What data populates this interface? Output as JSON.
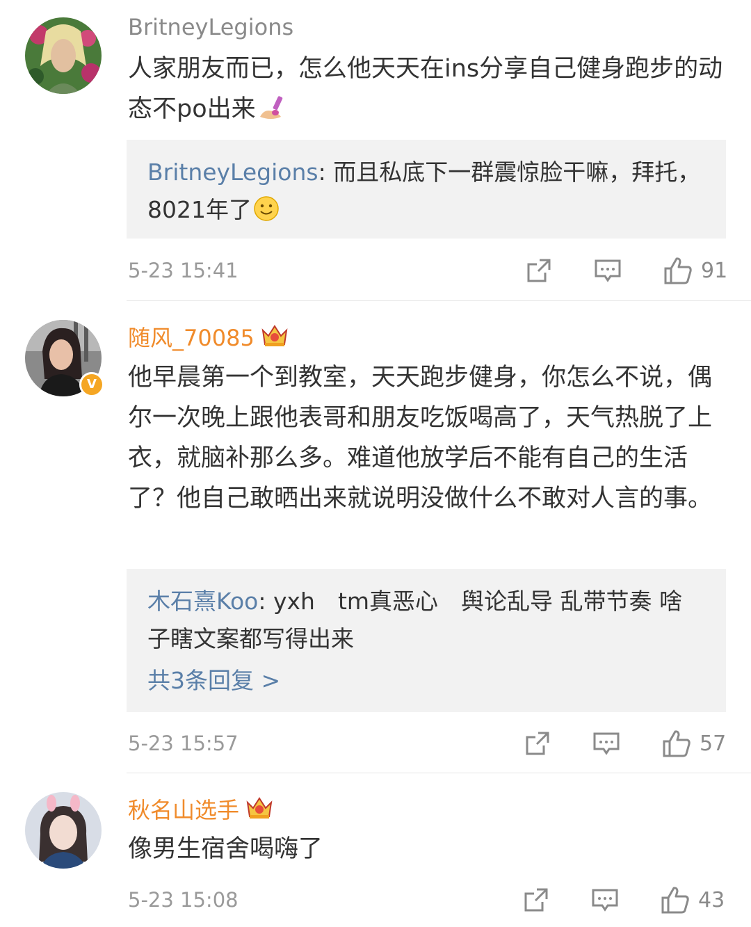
{
  "comments": [
    {
      "user": "BritneyLegions",
      "text": "人家朋友而已，怎么他天天在ins分享自己健身跑步的动态不po出来",
      "emoji": "nail-polish-emoji",
      "reply_user": "BritneyLegions",
      "reply_text": ": 而且私底下一群震惊脸干嘛，拜托，8021年了",
      "reply_emoji": "smile-emoji",
      "time": "5-23 15:41",
      "likes": "91"
    },
    {
      "user": "随风_70085",
      "badge": "crown-icon",
      "verified": "V",
      "text": "他早晨第一个到教室，天天跑步健身，你怎么不说，偶尔一次晚上跟他表哥和朋友吃饭喝高了，天气热脱了上衣，就脑补那么多。难道他放学后不能有自己的生活了？他自己敢晒出来就说明没做什么不敢对人言的事。",
      "reply_user": "木石熹Koo",
      "reply_text": ": yxh　tm真恶心　舆论乱导 乱带节奏 啥子瞎文案都写得出来",
      "more_replies": "共3条回复 >",
      "time": "5-23 15:57",
      "likes": "57"
    },
    {
      "user": "秋名山选手",
      "badge": "crown-icon",
      "text": "像男生宿舍喝嗨了",
      "time": "5-23 15:08",
      "likes": "43"
    }
  ],
  "icons": {
    "share": "share-icon",
    "comment": "comment-icon",
    "like": "thumbs-up-icon"
  },
  "colors": {
    "vip_name": "#f08b2b",
    "reply_name": "#5a7fa8",
    "reply_bg": "#f2f2f2"
  }
}
